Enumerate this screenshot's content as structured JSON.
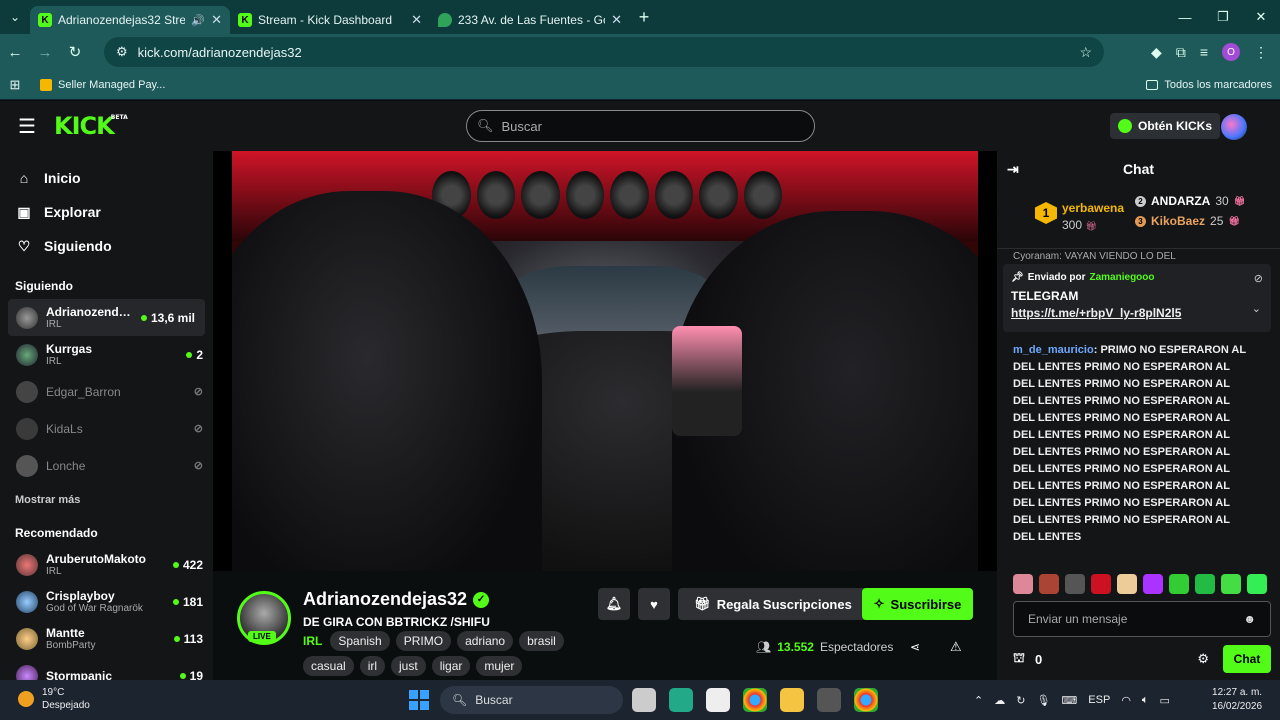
{
  "browser": {
    "tabs": [
      {
        "title": "Adrianozendejas32 Stream",
        "active": true,
        "audio": true
      },
      {
        "title": "Stream - Kick Dashboard",
        "active": false
      },
      {
        "title": "233 Av. de Las Fuentes - Googl",
        "active": false
      }
    ],
    "url": "kick.com/adrianozendejas32",
    "bookmark": "Seller Managed Pay...",
    "all_bookmarks": "Todos los marcadores",
    "profile_initial": "O"
  },
  "kick": {
    "logo": "KICK",
    "logo_badge": "BETA",
    "search_placeholder": "Buscar",
    "get_kicks": "Obtén KICKs",
    "brand_color": "#53fc18"
  },
  "sidebar": {
    "nav": [
      {
        "label": "Inicio",
        "icon": "home-icon"
      },
      {
        "label": "Explorar",
        "icon": "explore-icon"
      },
      {
        "label": "Siguiendo",
        "icon": "heart-icon"
      }
    ],
    "following_title": "Siguiendo",
    "following": [
      {
        "name": "Adrianozendej...",
        "category": "IRL",
        "viewers": "13,6 mil",
        "live": true
      },
      {
        "name": "Kurrgas",
        "category": "IRL",
        "viewers": "2",
        "live": true
      },
      {
        "name": "Edgar_Barron",
        "live": false
      },
      {
        "name": "KidaLs",
        "live": false
      },
      {
        "name": "Lonche",
        "live": false
      }
    ],
    "show_more": "Mostrar más",
    "recommended_title": "Recomendado",
    "recommended": [
      {
        "name": "AruberutoMakoto",
        "category": "IRL",
        "viewers": "422"
      },
      {
        "name": "Crisplayboy",
        "category": "God of War Ragnarök",
        "viewers": "181"
      },
      {
        "name": "Mantte",
        "category": "BombParty",
        "viewers": "113"
      },
      {
        "name": "Stormpanic",
        "category": "",
        "viewers": "19"
      }
    ]
  },
  "stream": {
    "channel": "Adrianozendejas32",
    "title": "DE GIRA CON BBTRICKZ  /SHIFU",
    "live_badge": "LIVE",
    "category": "IRL",
    "tags_row1": [
      "Spanish",
      "PRIMO",
      "adriano",
      "brasil"
    ],
    "tags_row2": [
      "casual",
      "irl",
      "just",
      "ligar",
      "mujer"
    ],
    "gift_label": "Regala Suscripciones",
    "subscribe_label": "Suscribirse",
    "viewers": "13.552",
    "viewers_label": "Espectadores"
  },
  "chat": {
    "title": "Chat",
    "leaderboard": {
      "first": {
        "rank": "1",
        "name": "yerbawena",
        "value": "300"
      },
      "second": {
        "rank": "2",
        "name": "ANDARZA",
        "value": "30"
      },
      "third": {
        "rank": "3",
        "name": "KikoBaez",
        "value": "25"
      }
    },
    "peek_text": "Cyoranam: VAYAN VIENDO LO DEL",
    "pinned": {
      "sent_by": "Enviado por",
      "user": "Zamaniegooo",
      "body": "TELEGRAM",
      "link": "https://t.me/+rbpV_ly-r8plN2l5"
    },
    "message": {
      "user": "m_de_mauricio",
      "text": "PRIMO NO ESPERARON AL DEL LENTES PRIMO NO ESPERARON AL DEL LENTES PRIMO NO ESPERARON AL DEL LENTES PRIMO NO ESPERARON AL DEL LENTES PRIMO NO ESPERARON AL DEL LENTES PRIMO NO ESPERARON AL DEL LENTES PRIMO NO ESPERARON AL DEL LENTES PRIMO NO ESPERARON AL DEL LENTES PRIMO NO ESPERARON AL DEL LENTES PRIMO NO ESPERARON AL DEL LENTES PRIMO NO ESPERARON AL DEL LENTES"
    },
    "input_placeholder": "Enviar un mensaje",
    "points": "0",
    "send_label": "Chat"
  },
  "taskbar": {
    "temp": "19°C",
    "weather": "Despejado",
    "search": "Buscar",
    "lang": "ESP",
    "time": "12:27 a. m.",
    "date": "16/02/2026"
  }
}
